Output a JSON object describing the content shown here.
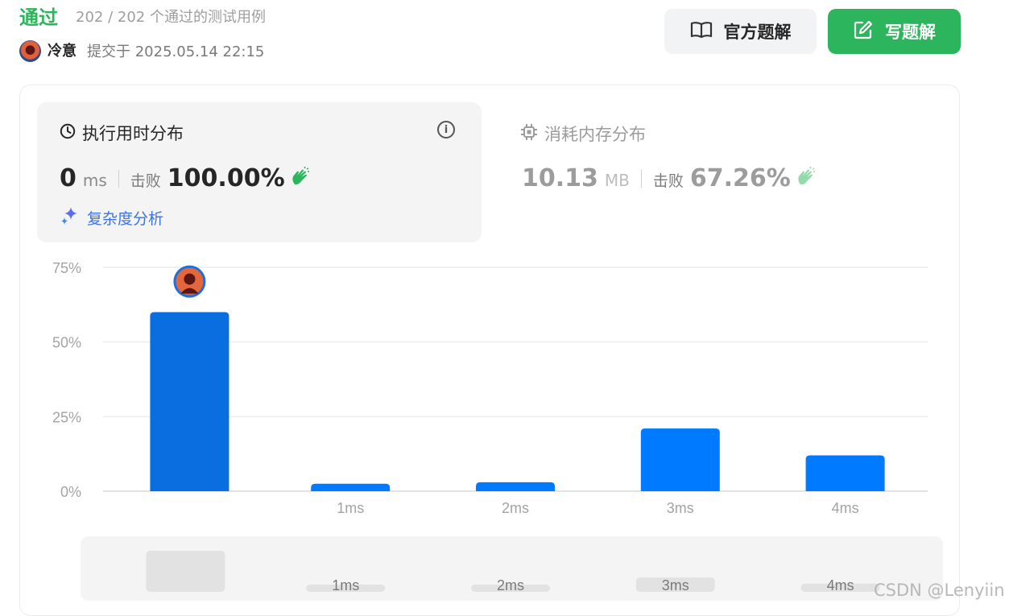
{
  "header": {
    "status": "通过",
    "cases": "202 / 202 个通过的测试用例",
    "user": "冷意",
    "submitted": "提交于 2025.05.14 22:15",
    "official_solution_label": "官方题解",
    "write_solution_label": "写题解"
  },
  "runtime": {
    "title": "执行用时分布",
    "value": "0",
    "unit": "ms",
    "beat_label": "击败",
    "beat_value": "100.00%",
    "complexity_label": "复杂度分析"
  },
  "memory": {
    "title": "消耗内存分布",
    "value": "10.13",
    "unit": "MB",
    "beat_label": "击败",
    "beat_value": "67.26%"
  },
  "colors": {
    "accent_green": "#2db55d",
    "bar_selected": "#0a6ee0",
    "bar": "#007aff",
    "link": "#3b73e6"
  },
  "icons": {
    "official": "book-open-icon",
    "write": "edit-icon",
    "runtime": "clock-icon",
    "info": "info-icon",
    "memory": "chip-icon",
    "beat": "clap-icon",
    "complexity": "sparkle-icon"
  },
  "chart_data": {
    "type": "bar",
    "categories": [
      "",
      "1ms",
      "2ms",
      "3ms",
      "4ms"
    ],
    "values": [
      60,
      2.5,
      3,
      21,
      12
    ],
    "ylim": [
      0,
      75
    ],
    "yticks": [
      "0%",
      "25%",
      "50%",
      "75%"
    ],
    "selected_index": 0,
    "grid": true
  },
  "mini_chart": {
    "categories": [
      "",
      "1ms",
      "2ms",
      "3ms",
      "4ms"
    ],
    "values": [
      60,
      2.5,
      3,
      21,
      12
    ]
  },
  "watermark": "CSDN @Lenyiin"
}
